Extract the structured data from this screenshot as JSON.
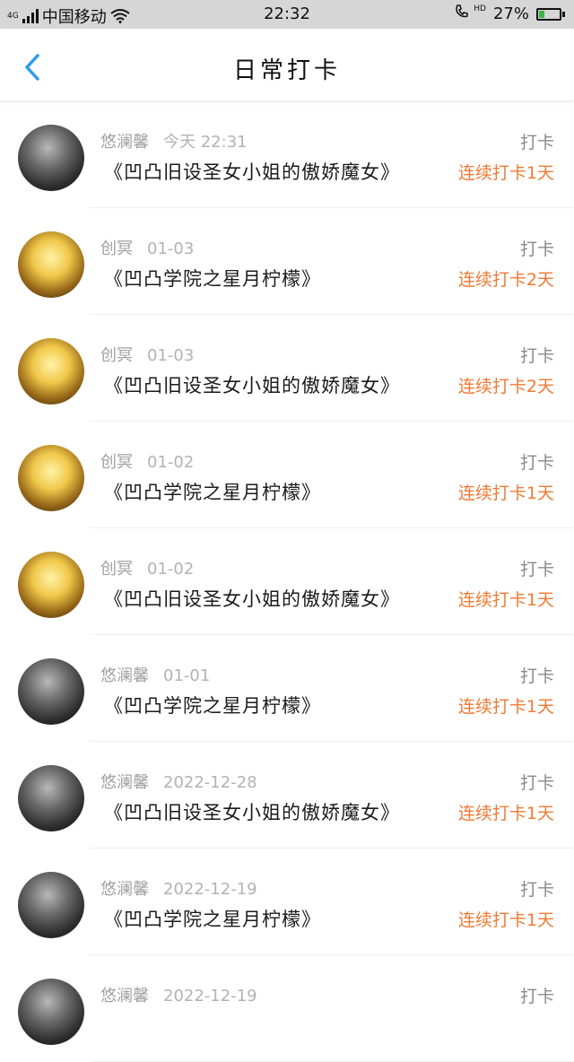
{
  "status_bar": {
    "network": "4G",
    "carrier": "中国移动",
    "time": "22:32",
    "hd": "HD",
    "battery": "27%",
    "battery_level": 0.27,
    "colors": {
      "battery_fill": "#3ab54a"
    }
  },
  "header": {
    "title": "日常打卡",
    "back_icon": "chevron-left-icon",
    "colors": {
      "back": "#2a9bf0"
    }
  },
  "checkins": [
    {
      "user": "悠澜馨",
      "date": "今天 22:31",
      "book": "《凹凸旧设圣女小姐的傲娇魔女》",
      "action": "打卡",
      "streak": "连续打卡1天",
      "avatar": "dark"
    },
    {
      "user": "创冥",
      "date": "01-03",
      "book": "《凹凸学院之星月柠檬》",
      "action": "打卡",
      "streak": "连续打卡2天",
      "avatar": "gold"
    },
    {
      "user": "创冥",
      "date": "01-03",
      "book": "《凹凸旧设圣女小姐的傲娇魔女》",
      "action": "打卡",
      "streak": "连续打卡2天",
      "avatar": "gold"
    },
    {
      "user": "创冥",
      "date": "01-02",
      "book": "《凹凸学院之星月柠檬》",
      "action": "打卡",
      "streak": "连续打卡1天",
      "avatar": "gold"
    },
    {
      "user": "创冥",
      "date": "01-02",
      "book": "《凹凸旧设圣女小姐的傲娇魔女》",
      "action": "打卡",
      "streak": "连续打卡1天",
      "avatar": "gold"
    },
    {
      "user": "悠澜馨",
      "date": "01-01",
      "book": "《凹凸学院之星月柠檬》",
      "action": "打卡",
      "streak": "连续打卡1天",
      "avatar": "dark"
    },
    {
      "user": "悠澜馨",
      "date": "2022-12-28",
      "book": "《凹凸旧设圣女小姐的傲娇魔女》",
      "action": "打卡",
      "streak": "连续打卡1天",
      "avatar": "dark"
    },
    {
      "user": "悠澜馨",
      "date": "2022-12-19",
      "book": "《凹凸学院之星月柠檬》",
      "action": "打卡",
      "streak": "连续打卡1天",
      "avatar": "dark"
    },
    {
      "user": "悠澜馨",
      "date": "2022-12-19",
      "book": "",
      "action": "打卡",
      "streak": "",
      "avatar": "dark"
    }
  ],
  "colors": {
    "streak": "#ef7a34",
    "meta": "#a0a0a0"
  }
}
